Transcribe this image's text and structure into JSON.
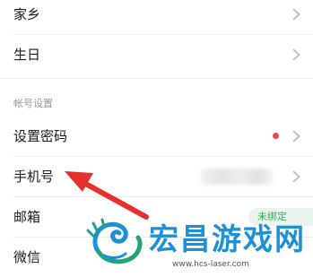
{
  "settings": {
    "rows_top": [
      {
        "label": "家乡"
      },
      {
        "label": "生日"
      }
    ],
    "account_section_title": "帐号设置",
    "set_password_label": "设置密码",
    "phone_label": "手机号",
    "email_label": "邮箱",
    "email_badge": "未绑定",
    "wechat_label": "微信"
  },
  "annotation": {
    "arrow_color": "#e5312d"
  },
  "watermark": {
    "brand": "宏昌游戏网",
    "url": "www.hcs-laser.com",
    "color": "#1f8fd6"
  },
  "icons": [
    "chevron-right-icon",
    "red-dot-icon",
    "red-arrow-annotation",
    "dragon-logo"
  ]
}
